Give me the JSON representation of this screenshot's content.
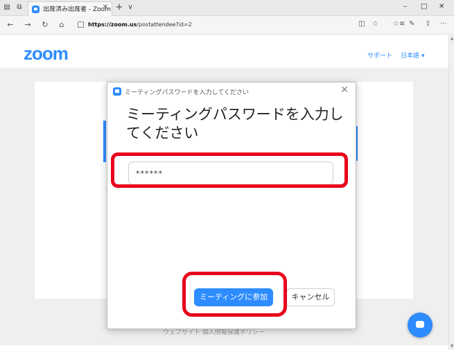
{
  "browser": {
    "tab_title": "出席済み出席者 - Zoom",
    "tab_close": "✕",
    "new_tab": "+",
    "tab_menu": "∨",
    "url_host": "https://zoom.us",
    "url_path": "/postattendee?id=2",
    "window": {
      "minimize": "–",
      "maximize": "□",
      "close": "✕"
    },
    "nav": {
      "back": "←",
      "forward": "→",
      "refresh": "↻",
      "home": "⌂"
    },
    "tools": [
      "◫",
      "☆",
      "☆≡",
      "✎",
      "⇪",
      "···"
    ]
  },
  "page": {
    "logo": "zoom",
    "support_link": "サポート",
    "language": "日本語 ▾",
    "footer_text": "ウェブサイト 個人情報保護ポリシー"
  },
  "dialog": {
    "window_title": "ミーティングパスワードを入力してください",
    "close": "✕",
    "heading": "ミーティングパスワードを入力してください",
    "password_value": "******",
    "join_button": "ミーティングに参加",
    "cancel_button": "キャンセル"
  },
  "colors": {
    "brand_blue": "#2d8cff",
    "highlight_red": "#e8001c"
  }
}
